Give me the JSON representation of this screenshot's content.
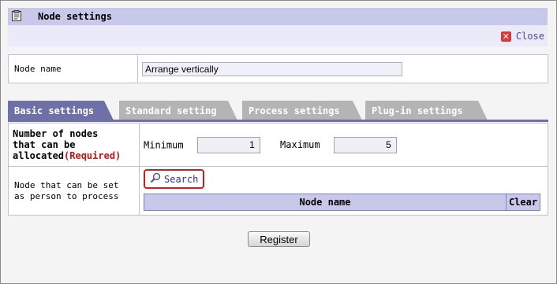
{
  "header": {
    "title": "Node settings",
    "icon": "clipboard-icon"
  },
  "close": {
    "label": "Close",
    "icon": "close-icon"
  },
  "node_name": {
    "label": "Node name",
    "value": "Arrange vertically"
  },
  "tabs": [
    {
      "label": "Basic settings",
      "active": true
    },
    {
      "label": "Standard setting",
      "active": false
    },
    {
      "label": "Process settings",
      "active": false
    },
    {
      "label": "Plug-in settings",
      "active": false
    }
  ],
  "allocation": {
    "label_line1": "Number of nodes",
    "label_line2": "that can be",
    "label_line3": "allocated",
    "required": "(Required)",
    "min_label": "Minimum",
    "min_value": "1",
    "max_label": "Maximum",
    "max_value": "5"
  },
  "process": {
    "label": "Node that can be set as person to process",
    "search_label": "Search",
    "search_icon": "magnifier-icon",
    "col_node_name": "Node name",
    "col_clear": "Clear"
  },
  "register_label": "Register",
  "colors": {
    "accent": "#7070a8",
    "header_bg": "#c8c8ea",
    "required": "#d01010"
  }
}
